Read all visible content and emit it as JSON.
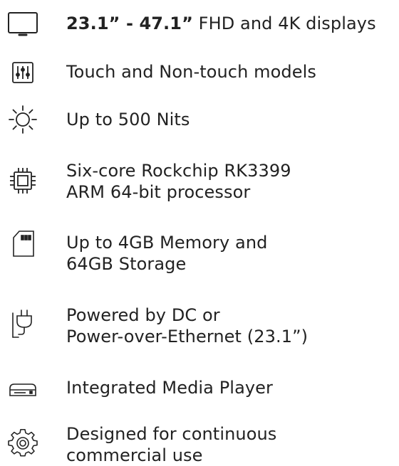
{
  "features": [
    {
      "icon": "display-monitor-icon",
      "bold": "23.1” - 47.1”",
      "lines": [
        " FHD and 4K displays"
      ]
    },
    {
      "icon": "touch-controls-icon",
      "lines": [
        "Touch and Non-touch models"
      ]
    },
    {
      "icon": "brightness-sun-icon",
      "lines": [
        "Up to 500 Nits"
      ]
    },
    {
      "icon": "processor-chip-icon",
      "lines": [
        "Six-core Rockchip RK3399",
        "ARM 64-bit processor"
      ]
    },
    {
      "icon": "memory-card-icon",
      "lines": [
        "Up to 4GB Memory and",
        "64GB Storage"
      ]
    },
    {
      "icon": "power-plug-icon",
      "lines": [
        "Powered by DC or",
        "Power-over-Ethernet (23.1”)"
      ]
    },
    {
      "icon": "media-player-icon",
      "lines": [
        "Integrated Media Player"
      ]
    },
    {
      "icon": "gear-icon",
      "lines": [
        "Designed for continuous",
        "commercial use"
      ]
    }
  ]
}
